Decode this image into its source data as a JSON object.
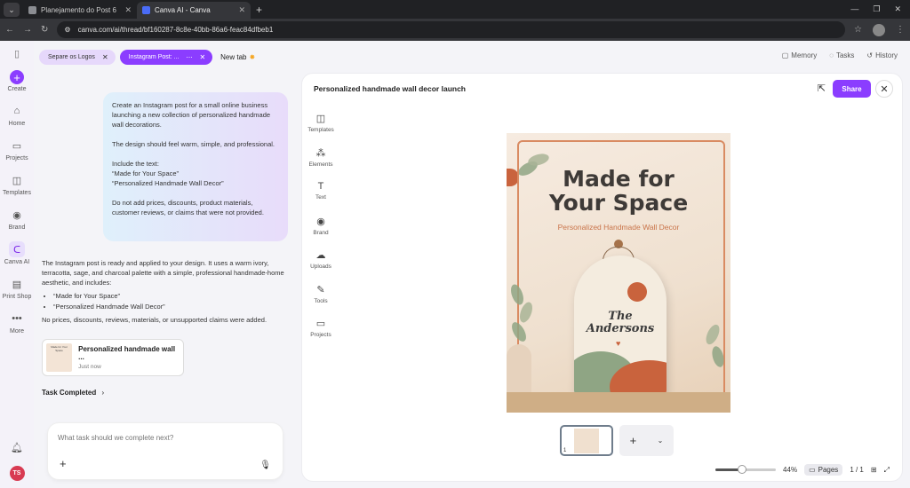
{
  "browser": {
    "tabs": [
      {
        "title": "Planejamento do Post 6",
        "active": false
      },
      {
        "title": "Canva AI - Canva",
        "active": true
      }
    ],
    "url": "canva.com/ai/thread/bf160287-8c8e-40bb-86a6-feac84dfbeb1"
  },
  "rail": {
    "create": "Create",
    "items": [
      {
        "label": "Home",
        "icon": "home-icon",
        "glyph": "⌂"
      },
      {
        "label": "Projects",
        "icon": "folder-icon",
        "glyph": "▭"
      },
      {
        "label": "Templates",
        "icon": "templates-icon",
        "glyph": "◫"
      },
      {
        "label": "Brand",
        "icon": "brand-icon",
        "glyph": "◉"
      },
      {
        "label": "Canva AI",
        "icon": "canva-ai-icon",
        "glyph": "ᑕ"
      },
      {
        "label": "Print Shop",
        "icon": "print-shop-icon",
        "glyph": "▤"
      },
      {
        "label": "More",
        "icon": "more-icon",
        "glyph": "•••"
      }
    ],
    "avatar": "TS"
  },
  "thread_tabs": {
    "pills": [
      {
        "label": "Separe os Logos",
        "active": false
      },
      {
        "label": "Instagram Post: ...",
        "active": true
      }
    ],
    "new_tab": "New tab"
  },
  "top_actions": {
    "memory": "Memory",
    "tasks": "Tasks",
    "history": "History"
  },
  "chat": {
    "user_message": [
      "Create an Instagram post for a small online business launching a new collection of personalized handmade wall decorations.",
      "The design should feel warm, simple, and professional.",
      "Include the text:",
      "“Made for Your Space”",
      "“Personalized Handmade Wall Decor”",
      "Do not add prices, discounts, product materials, customer reviews, or claims that were not provided."
    ],
    "ai_intro": "The Instagram post is ready and applied to your design. It uses a warm ivory, terracotta, sage, and charcoal palette with a simple, professional handmade-home aesthetic, and includes:",
    "ai_bullets": [
      "“Made for Your Space”",
      "“Personalized Handmade Wall Decor”"
    ],
    "ai_outro": "No prices, discounts, reviews, materials, or unsupported claims were added.",
    "design_card": {
      "title": "Personalized handmade wall ...",
      "subtitle": "Just now",
      "thumb_text": "Made for Your Space"
    },
    "task_completed": "Task Completed",
    "composer_placeholder": "What task should we complete next?"
  },
  "editor": {
    "title": "Personalized handmade wall decor launch",
    "share": "Share",
    "tools": [
      {
        "label": "Templates",
        "icon": "templates-icon",
        "glyph": "◫"
      },
      {
        "label": "Elements",
        "icon": "elements-icon",
        "glyph": "⁂"
      },
      {
        "label": "Text",
        "icon": "text-icon",
        "glyph": "T"
      },
      {
        "label": "Brand",
        "icon": "brand-icon",
        "glyph": "◉"
      },
      {
        "label": "Uploads",
        "icon": "uploads-icon",
        "glyph": "☁"
      },
      {
        "label": "Tools",
        "icon": "tools-icon",
        "glyph": "✎"
      },
      {
        "label": "Projects",
        "icon": "folder-icon",
        "glyph": "▭"
      }
    ],
    "design": {
      "headline_1": "Made for",
      "headline_2": "Your Space",
      "subline": "Personalized Handmade Wall Decor",
      "plaque_name_1": "The",
      "plaque_name_2": "Andersons"
    },
    "page_number": "1",
    "zoom": "44%",
    "zoom_fraction": 0.44,
    "pages_label": "Pages",
    "page_count": "1 / 1"
  },
  "colors": {
    "accent": "#8b3dff",
    "terracotta": "#c9633d",
    "sage": "#8fa584"
  }
}
